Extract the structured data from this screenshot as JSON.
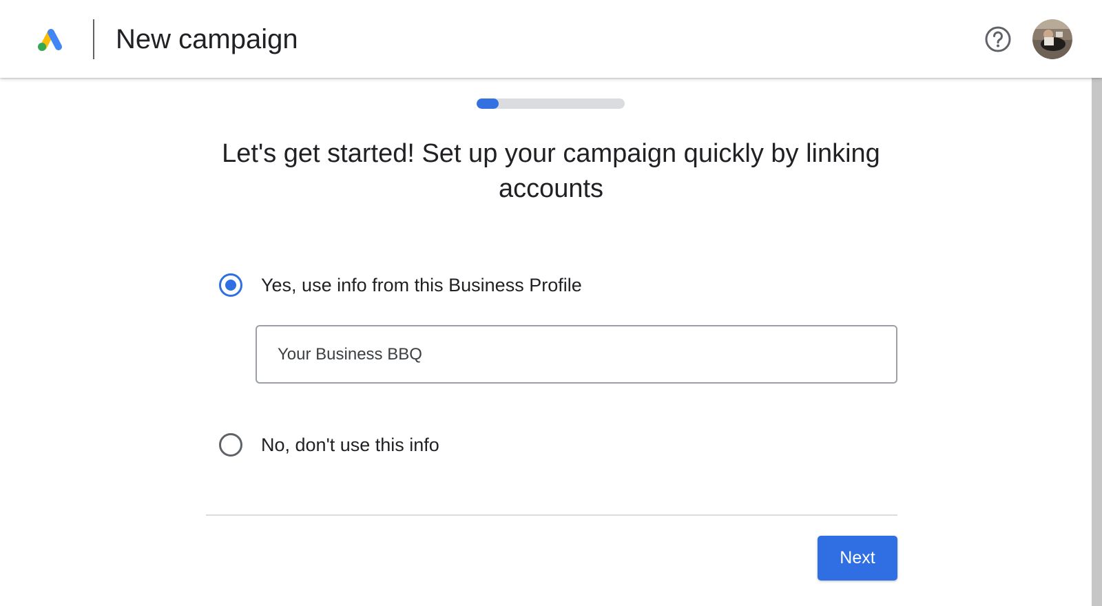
{
  "header": {
    "title": "New campaign",
    "logo_icon": "google-ads-logo",
    "help_icon": "help-circle-icon",
    "avatar_icon": "user-avatar"
  },
  "progress": {
    "fraction": 0.15,
    "color": "#3371e0"
  },
  "main": {
    "heading": "Let's get started! Set up your campaign quickly by linking accounts",
    "options": [
      {
        "label": "Yes, use info from this Business Profile",
        "selected": true
      },
      {
        "label": "No, don't use this info",
        "selected": false
      }
    ],
    "business_field": {
      "value": "Your Business BBQ"
    }
  },
  "footer": {
    "next_label": "Next"
  },
  "colors": {
    "accent": "#2f6ee3",
    "logo_blue": "#4285f4",
    "logo_yellow": "#fbbc04",
    "logo_green": "#34a853"
  }
}
